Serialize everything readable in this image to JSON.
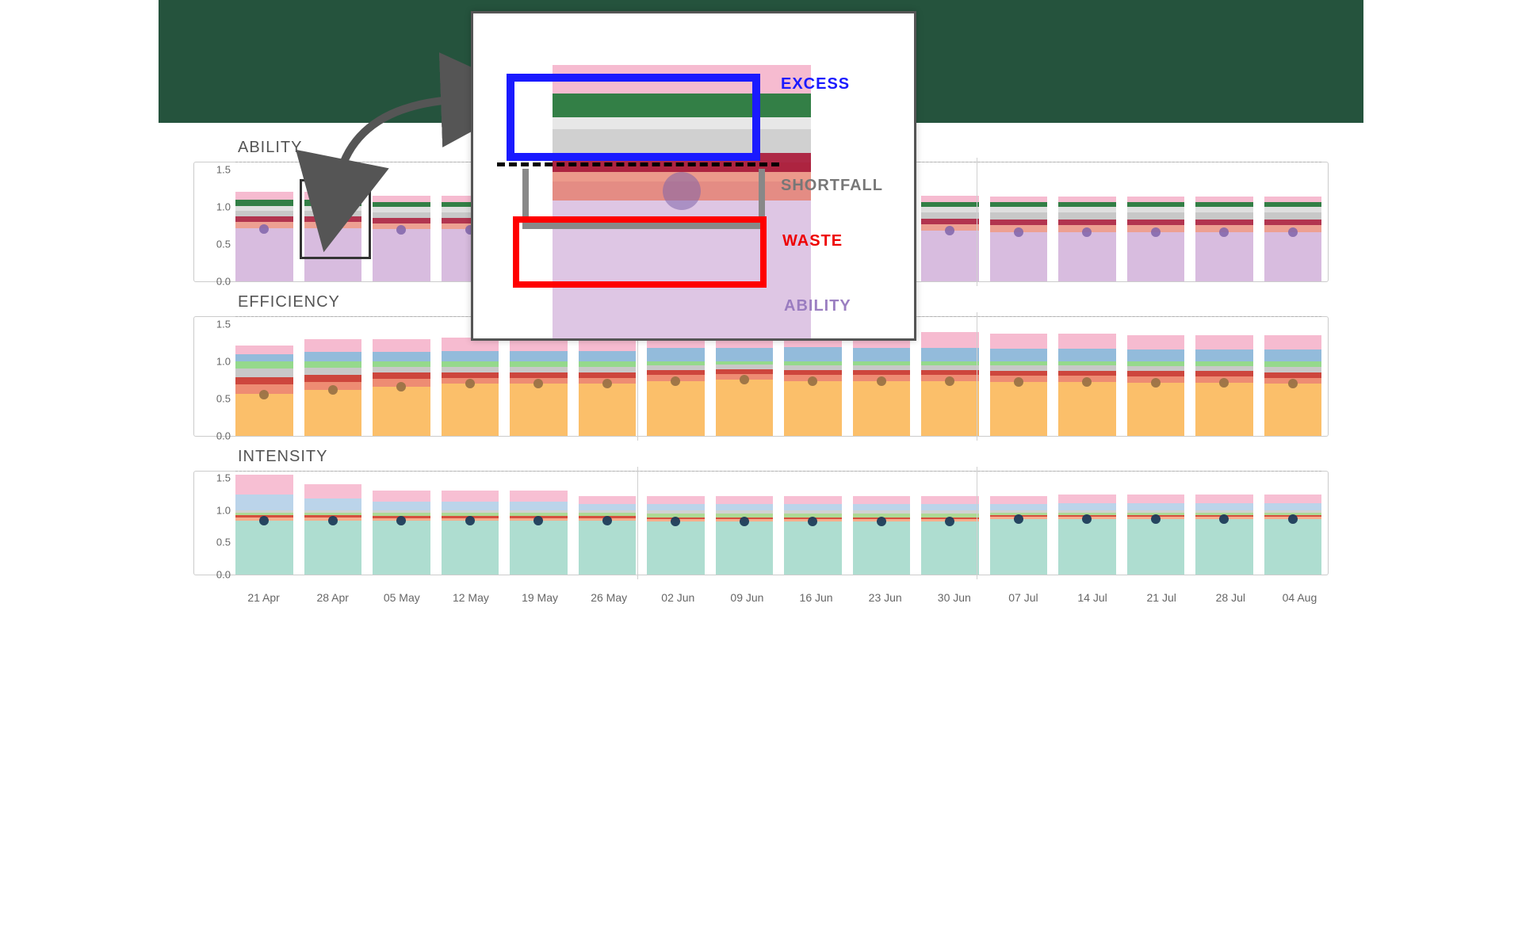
{
  "ymax": 1.6,
  "yticks": [
    "0.0",
    "0.5",
    "1.0",
    "1.5"
  ],
  "categories": [
    "21 Apr",
    "28 Apr",
    "05 May",
    "12 May",
    "19 May",
    "26 May",
    "02 Jun",
    "09 Jun",
    "16 Jun",
    "23 Jun",
    "30 Jun",
    "07 Jul",
    "14 Jul",
    "21 Jul",
    "28 Jul",
    "04 Aug"
  ],
  "gridBreaks": [
    6,
    11
  ],
  "panels": [
    {
      "id": "ability",
      "title": "ABILITY",
      "colors": {
        "base": "rgba(200,160,210,.7)",
        "waste1": "rgba(230,120,100,.7)",
        "waste2": "rgba(170,30,60,.9)",
        "short1": "rgba(190,190,190,.85)",
        "short2": "rgba(210,210,210,.7)",
        "exc1": "rgba(40,120,60,.95)",
        "exc2": "rgba(245,175,200,.85)",
        "dot": "rgba(128,100,170,.85)"
      },
      "series": [
        {
          "base": 0.72,
          "waste": 0.15,
          "short": 0.14,
          "exc": 0.2,
          "dot": 0.7
        },
        {
          "base": 0.72,
          "waste": 0.15,
          "short": 0.14,
          "exc": 0.2,
          "dot": 0.7
        },
        {
          "base": 0.7,
          "waste": 0.15,
          "short": 0.15,
          "exc": 0.15,
          "dot": 0.69
        },
        {
          "base": 0.7,
          "waste": 0.15,
          "short": 0.15,
          "exc": 0.15,
          "dot": 0.69
        },
        {
          "base": 0.7,
          "waste": 0.15,
          "short": 0.15,
          "exc": 0.15,
          "dot": 0.69
        },
        {
          "base": 0.7,
          "waste": 0.15,
          "short": 0.15,
          "exc": 0.15,
          "dot": 0.69
        },
        {
          "base": 0.68,
          "waste": 0.16,
          "short": 0.16,
          "exc": 0.15,
          "dot": 0.68
        },
        {
          "base": 0.68,
          "waste": 0.16,
          "short": 0.16,
          "exc": 0.15,
          "dot": 0.68
        },
        {
          "base": 0.68,
          "waste": 0.16,
          "short": 0.16,
          "exc": 0.15,
          "dot": 0.68
        },
        {
          "base": 0.68,
          "waste": 0.16,
          "short": 0.16,
          "exc": 0.15,
          "dot": 0.68
        },
        {
          "base": 0.68,
          "waste": 0.16,
          "short": 0.16,
          "exc": 0.15,
          "dot": 0.68
        },
        {
          "base": 0.66,
          "waste": 0.17,
          "short": 0.17,
          "exc": 0.14,
          "dot": 0.66
        },
        {
          "base": 0.66,
          "waste": 0.17,
          "short": 0.17,
          "exc": 0.14,
          "dot": 0.66
        },
        {
          "base": 0.66,
          "waste": 0.17,
          "short": 0.17,
          "exc": 0.14,
          "dot": 0.66
        },
        {
          "base": 0.66,
          "waste": 0.17,
          "short": 0.17,
          "exc": 0.14,
          "dot": 0.66
        },
        {
          "base": 0.66,
          "waste": 0.17,
          "short": 0.17,
          "exc": 0.14,
          "dot": 0.66
        }
      ]
    },
    {
      "id": "efficiency",
      "title": "EFFICIENCY",
      "colors": {
        "base": "rgba(250,180,80,.85)",
        "waste1": "rgba(235,120,90,.85)",
        "waste2": "rgba(200,50,40,.9)",
        "short1": "rgba(190,190,190,.85)",
        "short2": "rgba(130,210,120,.85)",
        "exc1": "rgba(135,180,215,.9)",
        "exc2": "rgba(245,175,200,.85)",
        "dot": "rgba(155,115,70,.95)"
      },
      "series": [
        {
          "base": 0.57,
          "waste": 0.22,
          "short": 0.21,
          "exc": 0.22,
          "dot": 0.56
        },
        {
          "base": 0.62,
          "waste": 0.2,
          "short": 0.18,
          "exc": 0.3,
          "dot": 0.62
        },
        {
          "base": 0.66,
          "waste": 0.19,
          "short": 0.15,
          "exc": 0.3,
          "dot": 0.66
        },
        {
          "base": 0.7,
          "waste": 0.15,
          "short": 0.15,
          "exc": 0.32,
          "dot": 0.7
        },
        {
          "base": 0.7,
          "waste": 0.15,
          "short": 0.15,
          "exc": 0.32,
          "dot": 0.7
        },
        {
          "base": 0.7,
          "waste": 0.15,
          "short": 0.15,
          "exc": 0.32,
          "dot": 0.7
        },
        {
          "base": 0.74,
          "waste": 0.15,
          "short": 0.11,
          "exc": 0.42,
          "dot": 0.74
        },
        {
          "base": 0.76,
          "waste": 0.14,
          "short": 0.1,
          "exc": 0.42,
          "dot": 0.76
        },
        {
          "base": 0.74,
          "waste": 0.15,
          "short": 0.11,
          "exc": 0.44,
          "dot": 0.74
        },
        {
          "base": 0.74,
          "waste": 0.15,
          "short": 0.11,
          "exc": 0.4,
          "dot": 0.74
        },
        {
          "base": 0.74,
          "waste": 0.15,
          "short": 0.11,
          "exc": 0.4,
          "dot": 0.74
        },
        {
          "base": 0.73,
          "waste": 0.15,
          "short": 0.12,
          "exc": 0.38,
          "dot": 0.73
        },
        {
          "base": 0.73,
          "waste": 0.15,
          "short": 0.12,
          "exc": 0.38,
          "dot": 0.73
        },
        {
          "base": 0.72,
          "waste": 0.15,
          "short": 0.13,
          "exc": 0.36,
          "dot": 0.72
        },
        {
          "base": 0.72,
          "waste": 0.15,
          "short": 0.13,
          "exc": 0.36,
          "dot": 0.72
        },
        {
          "base": 0.7,
          "waste": 0.15,
          "short": 0.15,
          "exc": 0.36,
          "dot": 0.7
        }
      ]
    },
    {
      "id": "intensity",
      "title": "INTENSITY",
      "colors": {
        "base": "rgba(160,215,200,.85)",
        "waste1": "rgba(245,160,120,.85)",
        "waste2": "rgba(210,60,40,.9)",
        "short1": "rgba(160,210,130,.85)",
        "short2": "rgba(190,190,190,.7)",
        "exc1": "rgba(175,205,230,.85)",
        "exc2": "rgba(245,175,200,.8)",
        "dot": "rgba(30,60,90,.95)"
      },
      "series": [
        {
          "base": 0.84,
          "waste": 0.08,
          "short": 0.08,
          "exc": 0.55,
          "dot": 0.84
        },
        {
          "base": 0.84,
          "waste": 0.08,
          "short": 0.08,
          "exc": 0.4,
          "dot": 0.84
        },
        {
          "base": 0.84,
          "waste": 0.07,
          "short": 0.09,
          "exc": 0.3,
          "dot": 0.84
        },
        {
          "base": 0.84,
          "waste": 0.07,
          "short": 0.09,
          "exc": 0.3,
          "dot": 0.84
        },
        {
          "base": 0.84,
          "waste": 0.07,
          "short": 0.09,
          "exc": 0.3,
          "dot": 0.84
        },
        {
          "base": 0.84,
          "waste": 0.07,
          "short": 0.09,
          "exc": 0.22,
          "dot": 0.84
        },
        {
          "base": 0.82,
          "waste": 0.07,
          "short": 0.11,
          "exc": 0.22,
          "dot": 0.82
        },
        {
          "base": 0.82,
          "waste": 0.07,
          "short": 0.11,
          "exc": 0.22,
          "dot": 0.82
        },
        {
          "base": 0.82,
          "waste": 0.07,
          "short": 0.11,
          "exc": 0.22,
          "dot": 0.82
        },
        {
          "base": 0.82,
          "waste": 0.07,
          "short": 0.11,
          "exc": 0.22,
          "dot": 0.82
        },
        {
          "base": 0.82,
          "waste": 0.07,
          "short": 0.11,
          "exc": 0.22,
          "dot": 0.82
        },
        {
          "base": 0.86,
          "waste": 0.06,
          "short": 0.08,
          "exc": 0.22,
          "dot": 0.86
        },
        {
          "base": 0.86,
          "waste": 0.06,
          "short": 0.08,
          "exc": 0.24,
          "dot": 0.86
        },
        {
          "base": 0.86,
          "waste": 0.06,
          "short": 0.08,
          "exc": 0.24,
          "dot": 0.86
        },
        {
          "base": 0.86,
          "waste": 0.06,
          "short": 0.08,
          "exc": 0.24,
          "dot": 0.86
        },
        {
          "base": 0.86,
          "waste": 0.06,
          "short": 0.08,
          "exc": 0.24,
          "dot": 0.86
        }
      ]
    }
  ],
  "callout": {
    "labels": {
      "excess": "EXCESS",
      "shortfall": "SHORTFALL",
      "waste": "WASTE",
      "ability": "ABILITY"
    }
  },
  "chart_data": {
    "type": "bar",
    "title": "Weekly KPI decomposition with callout explaining Excess / Shortfall / Waste / Ability segments",
    "xlabel": "",
    "ylabel": "",
    "ylim": [
      0,
      1.6
    ],
    "reference_line": 1.0,
    "x": [
      "21 Apr",
      "28 Apr",
      "05 May",
      "12 May",
      "19 May",
      "26 May",
      "02 Jun",
      "09 Jun",
      "16 Jun",
      "23 Jun",
      "30 Jun",
      "07 Jul",
      "14 Jul",
      "21 Jul",
      "28 Jul",
      "04 Aug"
    ],
    "panels": [
      {
        "name": "ABILITY",
        "segments": [
          "ability_base",
          "waste",
          "shortfall",
          "excess"
        ],
        "marker": "dot",
        "series": {
          "ability_base": [
            0.72,
            0.72,
            0.7,
            0.7,
            0.7,
            0.7,
            0.68,
            0.68,
            0.68,
            0.68,
            0.68,
            0.66,
            0.66,
            0.66,
            0.66,
            0.66
          ],
          "waste": [
            0.15,
            0.15,
            0.15,
            0.15,
            0.15,
            0.15,
            0.16,
            0.16,
            0.16,
            0.16,
            0.16,
            0.17,
            0.17,
            0.17,
            0.17,
            0.17
          ],
          "shortfall": [
            0.14,
            0.14,
            0.15,
            0.15,
            0.15,
            0.15,
            0.16,
            0.16,
            0.16,
            0.16,
            0.16,
            0.17,
            0.17,
            0.17,
            0.17,
            0.17
          ],
          "excess": [
            0.2,
            0.2,
            0.15,
            0.15,
            0.15,
            0.15,
            0.15,
            0.15,
            0.15,
            0.15,
            0.15,
            0.14,
            0.14,
            0.14,
            0.14,
            0.14
          ],
          "dot": [
            0.7,
            0.7,
            0.69,
            0.69,
            0.69,
            0.69,
            0.68,
            0.68,
            0.68,
            0.68,
            0.68,
            0.66,
            0.66,
            0.66,
            0.66,
            0.66
          ]
        }
      },
      {
        "name": "EFFICIENCY",
        "segments": [
          "efficiency_base",
          "waste",
          "shortfall",
          "excess"
        ],
        "marker": "dot",
        "series": {
          "efficiency_base": [
            0.57,
            0.62,
            0.66,
            0.7,
            0.7,
            0.7,
            0.74,
            0.76,
            0.74,
            0.74,
            0.74,
            0.73,
            0.73,
            0.72,
            0.72,
            0.7
          ],
          "waste": [
            0.22,
            0.2,
            0.19,
            0.15,
            0.15,
            0.15,
            0.15,
            0.14,
            0.15,
            0.15,
            0.15,
            0.15,
            0.15,
            0.15,
            0.15,
            0.15
          ],
          "shortfall": [
            0.21,
            0.18,
            0.15,
            0.15,
            0.15,
            0.15,
            0.11,
            0.1,
            0.11,
            0.11,
            0.11,
            0.12,
            0.12,
            0.13,
            0.13,
            0.15
          ],
          "excess": [
            0.22,
            0.3,
            0.3,
            0.32,
            0.32,
            0.32,
            0.42,
            0.42,
            0.44,
            0.4,
            0.4,
            0.38,
            0.38,
            0.36,
            0.36,
            0.36
          ],
          "dot": [
            0.56,
            0.62,
            0.66,
            0.7,
            0.7,
            0.7,
            0.74,
            0.76,
            0.74,
            0.74,
            0.74,
            0.73,
            0.73,
            0.72,
            0.72,
            0.7
          ]
        }
      },
      {
        "name": "INTENSITY",
        "segments": [
          "intensity_base",
          "waste",
          "shortfall",
          "excess"
        ],
        "marker": "dot",
        "series": {
          "intensity_base": [
            0.84,
            0.84,
            0.84,
            0.84,
            0.84,
            0.84,
            0.82,
            0.82,
            0.82,
            0.82,
            0.82,
            0.86,
            0.86,
            0.86,
            0.86,
            0.86
          ],
          "waste": [
            0.08,
            0.08,
            0.07,
            0.07,
            0.07,
            0.07,
            0.07,
            0.07,
            0.07,
            0.07,
            0.07,
            0.06,
            0.06,
            0.06,
            0.06,
            0.06
          ],
          "shortfall": [
            0.08,
            0.08,
            0.09,
            0.09,
            0.09,
            0.09,
            0.11,
            0.11,
            0.11,
            0.11,
            0.11,
            0.08,
            0.08,
            0.08,
            0.08,
            0.08
          ],
          "excess": [
            0.55,
            0.4,
            0.3,
            0.3,
            0.3,
            0.22,
            0.22,
            0.22,
            0.22,
            0.22,
            0.22,
            0.22,
            0.24,
            0.24,
            0.24,
            0.24
          ],
          "dot": [
            0.84,
            0.84,
            0.84,
            0.84,
            0.84,
            0.84,
            0.82,
            0.82,
            0.82,
            0.82,
            0.82,
            0.86,
            0.86,
            0.86,
            0.86,
            0.86
          ]
        }
      }
    ],
    "annotations": [
      "EXCESS",
      "SHORTFALL",
      "WASTE",
      "ABILITY"
    ]
  }
}
